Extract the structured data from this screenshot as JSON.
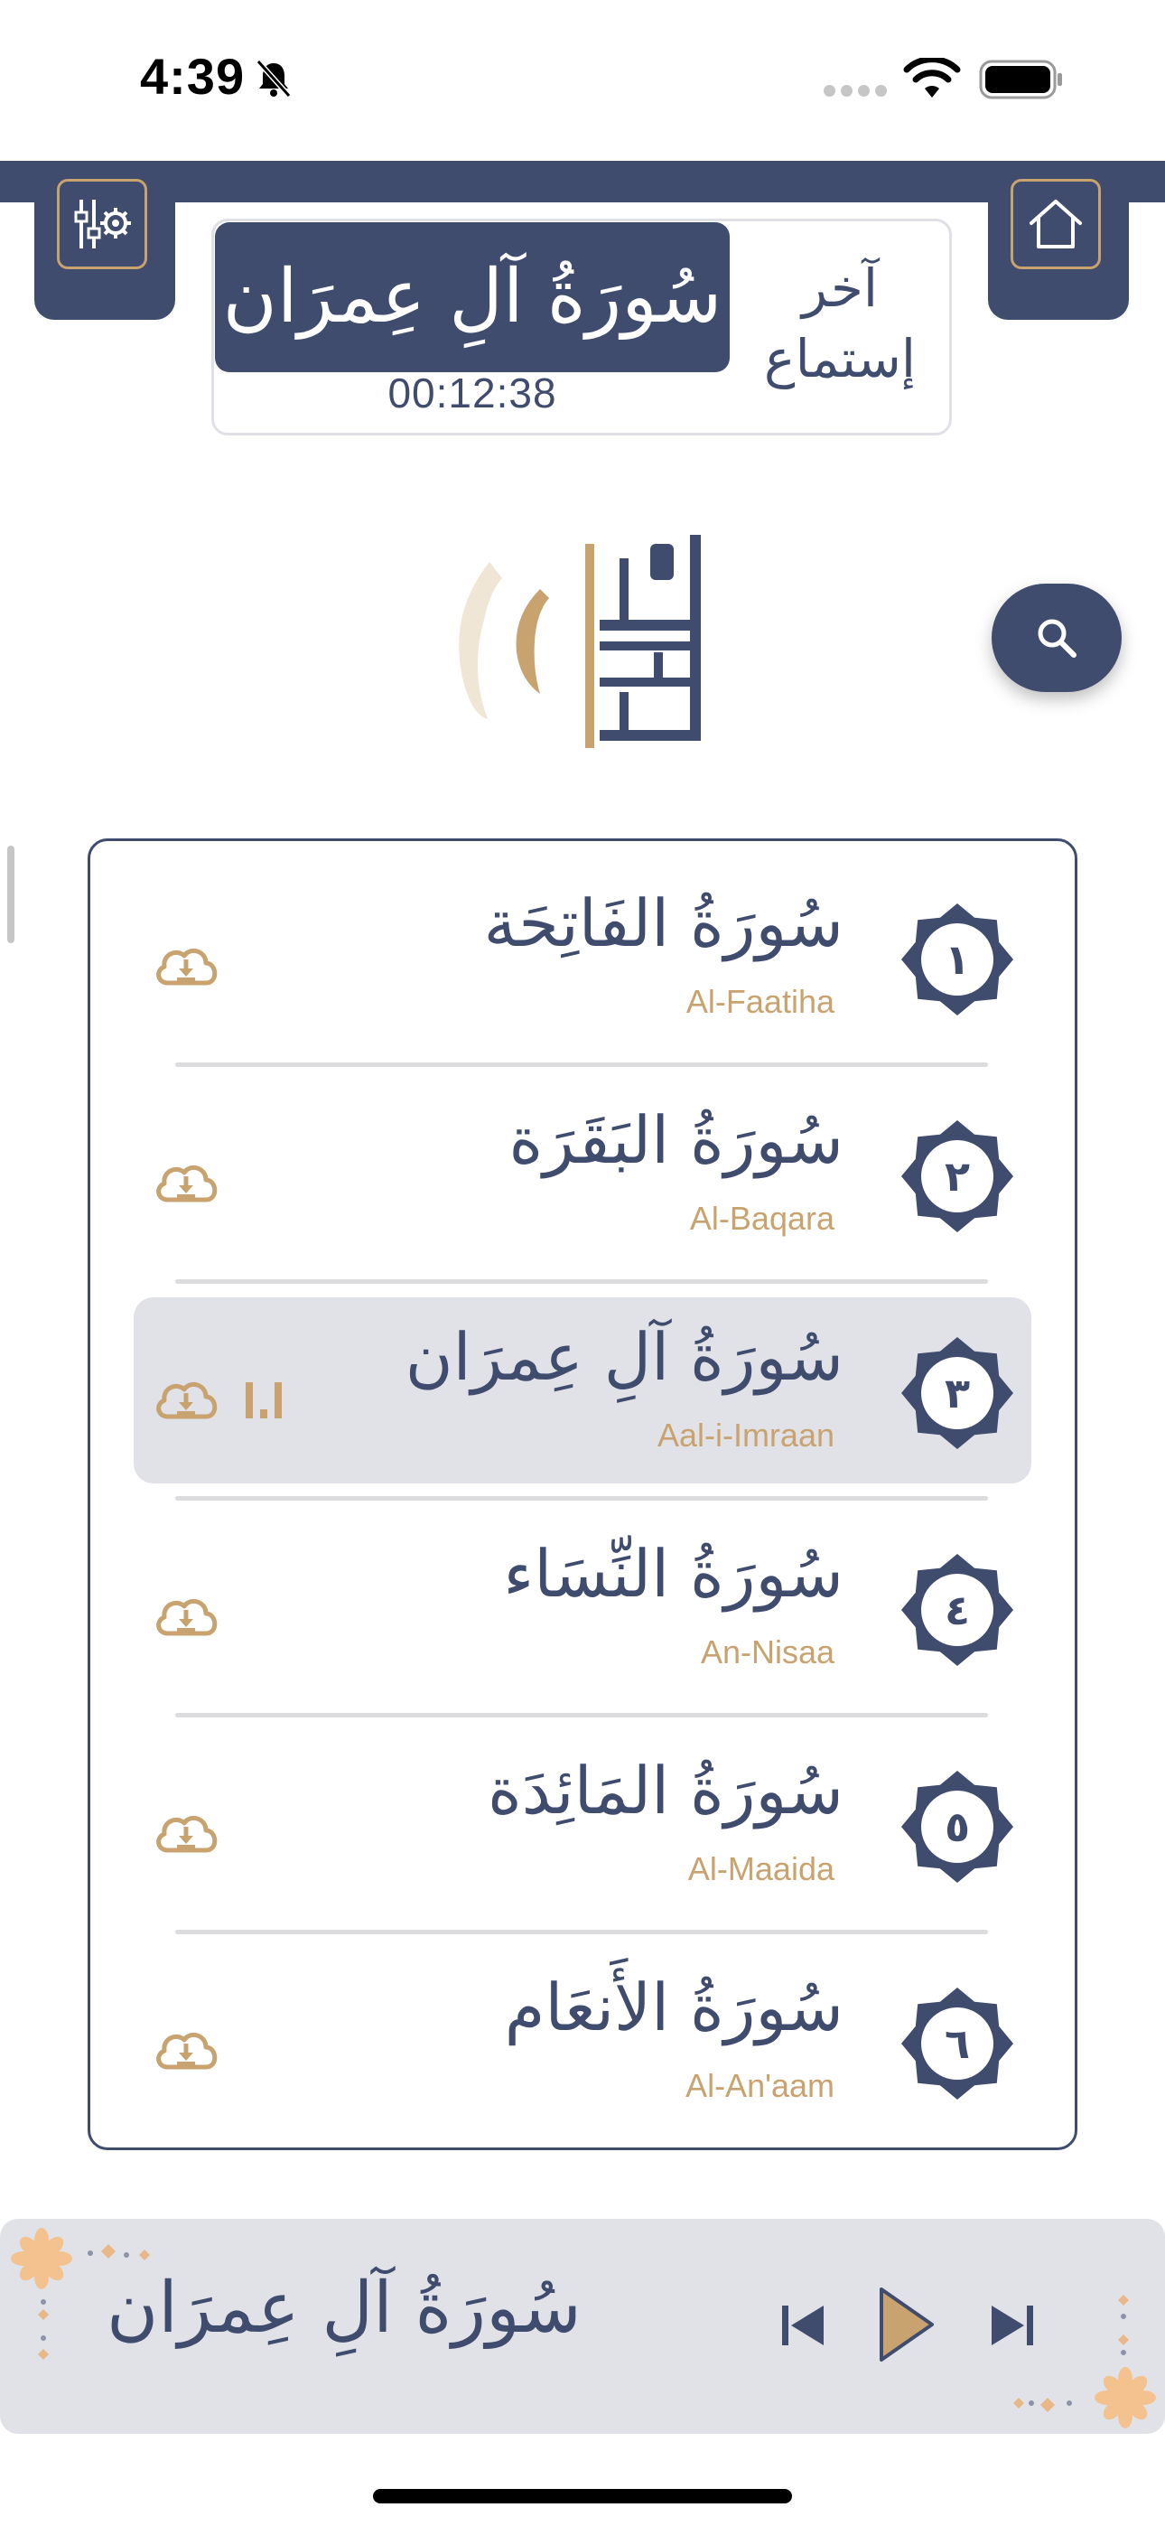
{
  "status_bar": {
    "time": "4:39"
  },
  "header": {
    "last_listened_label": "آخر إستماع",
    "last_surah": "سُورَةُ آلِ عِمرَان",
    "last_time": "00:12:38"
  },
  "surahs": [
    {
      "number": "١",
      "arabic": "سُورَةُ الفَاتِحَة",
      "english": "Al-Faatiha",
      "selected": false
    },
    {
      "number": "٢",
      "arabic": "سُورَةُ البَقَرَة",
      "english": "Al-Baqara",
      "selected": false
    },
    {
      "number": "٣",
      "arabic": "سُورَةُ آلِ عِمرَان",
      "english": "Aal-i-Imraan",
      "selected": true
    },
    {
      "number": "٤",
      "arabic": "سُورَةُ النِّسَاء",
      "english": "An-Nisaa",
      "selected": false
    },
    {
      "number": "٥",
      "arabic": "سُورَةُ المَائِدَة",
      "english": "Al-Maaida",
      "selected": false
    },
    {
      "number": "٦",
      "arabic": "سُورَةُ الأَنعَام",
      "english": "Al-An'aam",
      "selected": false
    }
  ],
  "player": {
    "surah": "سُورَةُ آلِ عِمرَان"
  },
  "colors": {
    "primary": "#3f4c6e",
    "accent": "#c9a36f",
    "selected_bg": "#e1e2e7"
  },
  "icons": {
    "settings": "sliders-gear-icon",
    "home": "home-icon",
    "search": "search-icon",
    "download": "cloud-download-icon",
    "playing": "equalizer-icon",
    "previous": "skip-previous-icon",
    "play": "play-icon",
    "next": "skip-next-icon"
  }
}
